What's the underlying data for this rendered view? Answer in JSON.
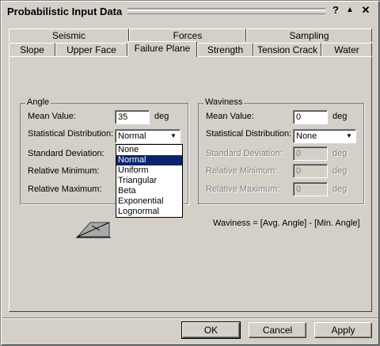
{
  "window": {
    "title": "Probabilistic Input Data"
  },
  "titlebar": {
    "help": "?",
    "rollup": "▲",
    "close": "✕"
  },
  "tabs_back": [
    "Seismic",
    "Forces",
    "Sampling"
  ],
  "tabs_front": [
    "Slope",
    "Upper Face",
    "Failure Plane",
    "Strength",
    "Tension Crack",
    "Water"
  ],
  "active_tab": "Failure Plane",
  "angle": {
    "legend": "Angle",
    "mean_label": "Mean Value:",
    "mean_value": "35",
    "mean_unit": "deg",
    "dist_label": "Statistical Distribution:",
    "dist_value": "Normal",
    "std_label": "Standard Deviation:",
    "min_label": "Relative Minimum:",
    "max_label": "Relative Maximum:"
  },
  "dropdown_options": [
    "None",
    "Normal",
    "Uniform",
    "Triangular",
    "Beta",
    "Exponential",
    "Lognormal"
  ],
  "dropdown_selected": "Normal",
  "waviness": {
    "legend": "Waviness",
    "mean_label": "Mean Value:",
    "mean_value": "0",
    "mean_unit": "deg",
    "dist_label": "Statistical Distribution:",
    "dist_value": "None",
    "std_label": "Standard Deviation:",
    "std_value": "0",
    "std_unit": "deg",
    "min_label": "Relative Minimum:",
    "min_value": "0",
    "min_unit": "deg",
    "max_label": "Relative Maximum:",
    "max_value": "0",
    "max_unit": "deg",
    "formula": "Waviness = [Avg. Angle] - [Min. Angle]"
  },
  "buttons": {
    "ok": "OK",
    "cancel": "Cancel",
    "apply": "Apply"
  }
}
